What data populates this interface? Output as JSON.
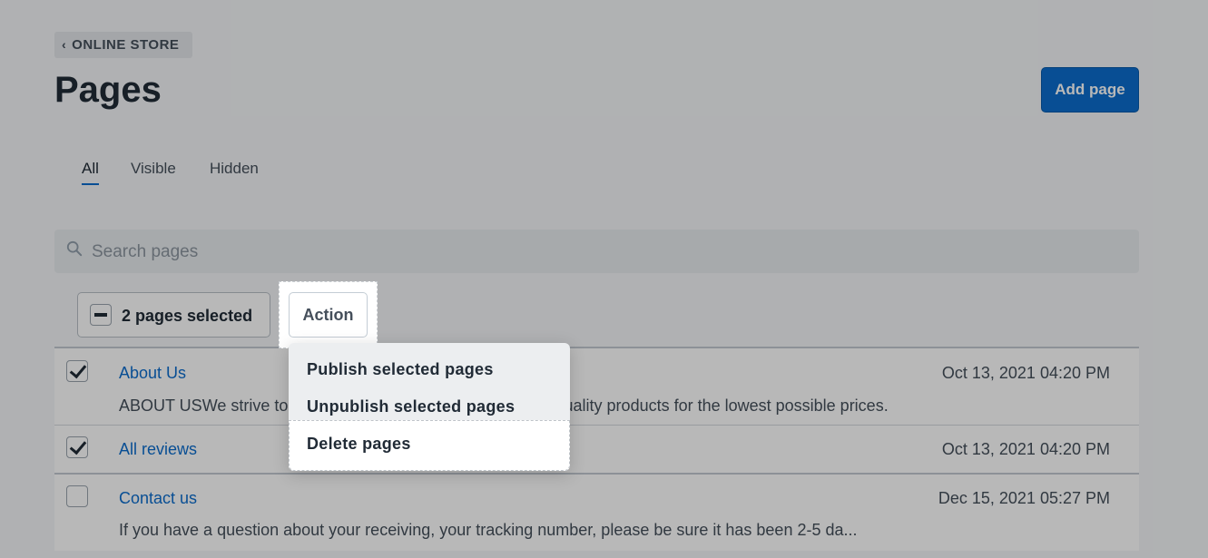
{
  "breadcrumb": {
    "label": "ONLINE STORE"
  },
  "header": {
    "title": "Pages",
    "add_button": "Add page"
  },
  "tabs": [
    {
      "label": "All",
      "active": true
    },
    {
      "label": "Visible",
      "active": false
    },
    {
      "label": "Hidden",
      "active": false
    }
  ],
  "search": {
    "placeholder": "Search pages"
  },
  "bulk": {
    "selected_label": "2 pages selected",
    "action_label": "Action"
  },
  "action_menu": {
    "items": [
      {
        "label": "Publish selected pages"
      },
      {
        "label": "Unpublish selected pages"
      },
      {
        "label": "Delete pages"
      }
    ]
  },
  "pages": [
    {
      "title": "About Us",
      "checked": true,
      "date": "Oct 13, 2021 04:20 PM",
      "excerpt": "ABOUT USWe strive to provide our customers with the best quality products for the lowest possible prices. Ou..."
    },
    {
      "title": "All reviews",
      "checked": true,
      "date": "Oct 13, 2021 04:20 PM",
      "excerpt": ""
    },
    {
      "title": "Contact us",
      "checked": false,
      "date": "Dec 15, 2021 05:27 PM",
      "excerpt": "If you have a question about your receiving, your tracking number, please be sure it has been 2-5 da..."
    }
  ],
  "colors": {
    "primary": "#0c6dcd",
    "link": "#0c6dcd",
    "text": "#212b36",
    "backdrop": "rgba(0,0,0,0.28)"
  }
}
